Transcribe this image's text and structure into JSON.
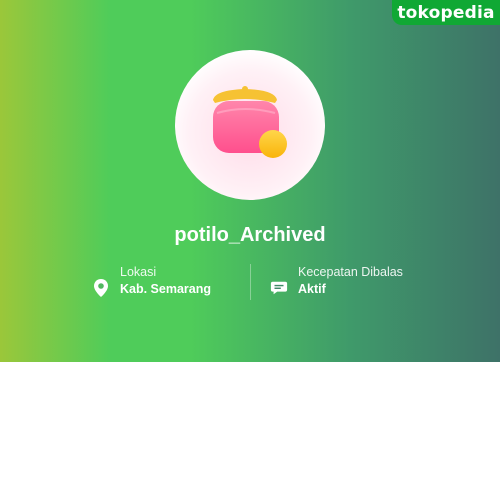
{
  "brand": {
    "logo_text": "tokopedia"
  },
  "shop": {
    "name": "potilo_Archived",
    "avatar_icon": "purse-icon"
  },
  "info": {
    "location": {
      "label": "Lokasi",
      "value": "Kab. Semarang",
      "icon": "location-pin-icon"
    },
    "response": {
      "label": "Kecepatan Dibalas",
      "value": "Aktif",
      "icon": "chat-bubble-icon"
    }
  },
  "colors": {
    "brand_green": "#10a834",
    "gradient_start": "#9bc73a",
    "gradient_mid": "#4fcc5a",
    "gradient_end": "#3e7268"
  }
}
